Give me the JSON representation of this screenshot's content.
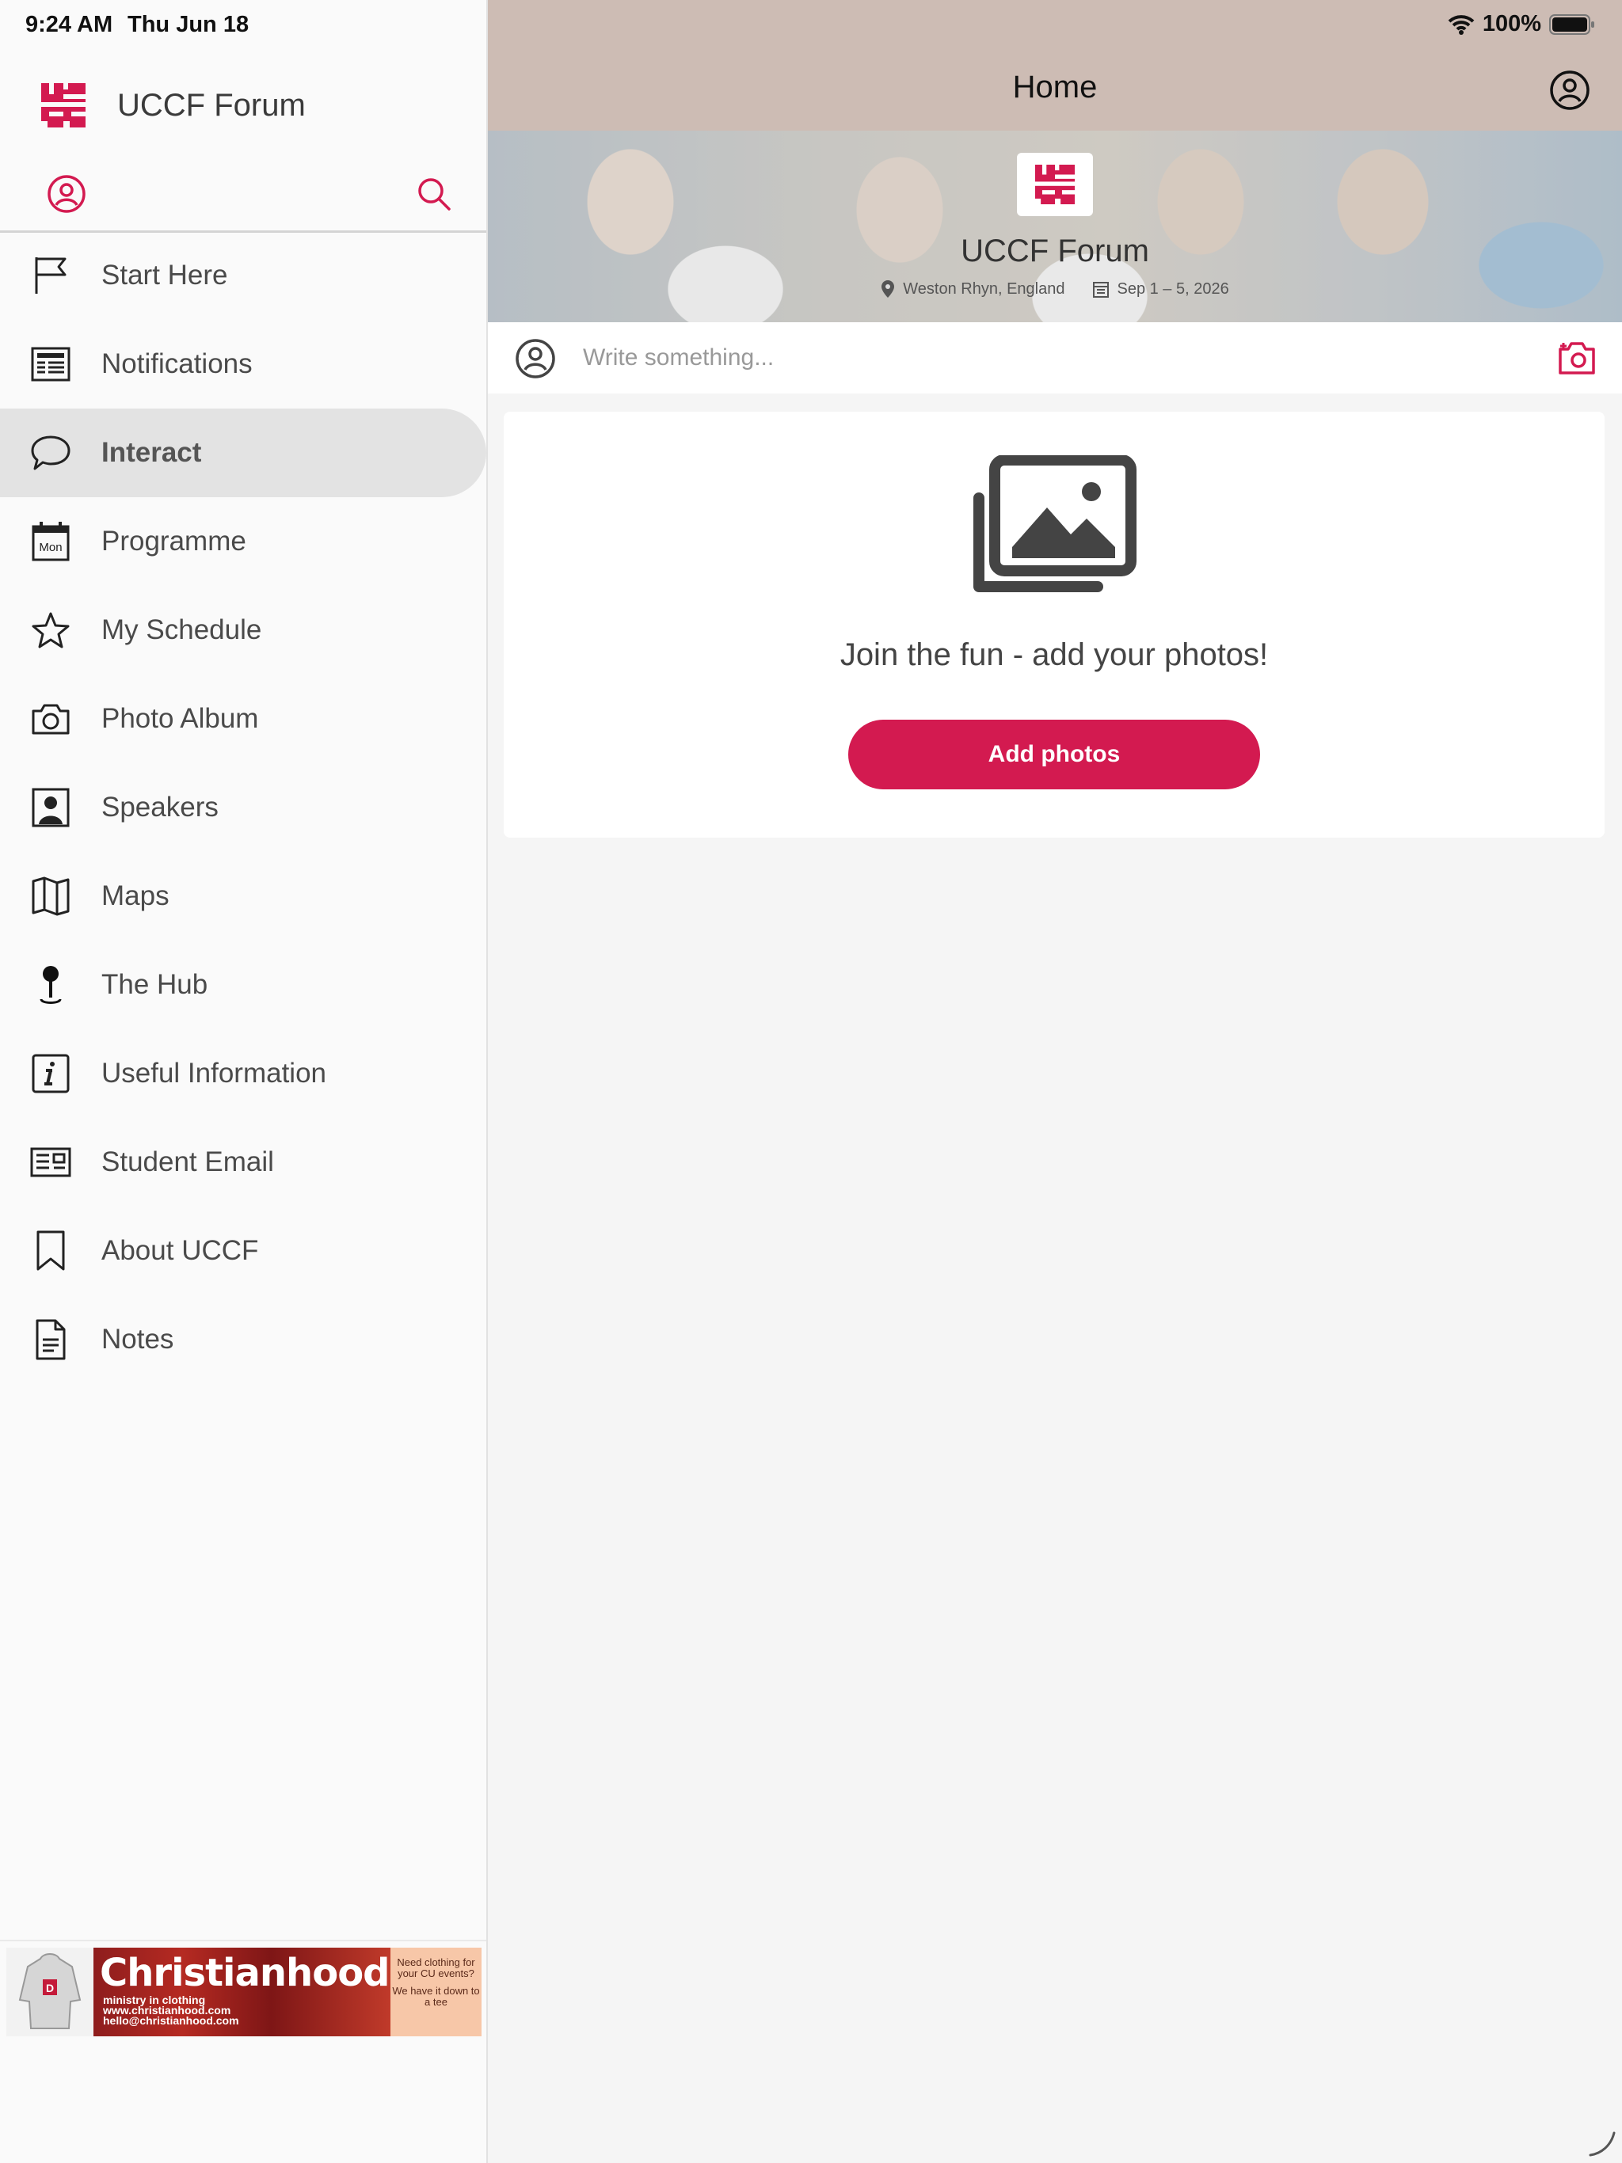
{
  "status_bar": {
    "time": "9:24 AM",
    "date": "Thu Jun 18",
    "battery": "100%"
  },
  "sidebar": {
    "title": "UCCF Forum",
    "items": [
      {
        "label": "Start Here",
        "icon": "flag-icon"
      },
      {
        "label": "Notifications",
        "icon": "newspaper-icon"
      },
      {
        "label": "Interact",
        "icon": "chat-bubble-icon",
        "active": true
      },
      {
        "label": "Programme",
        "icon": "calendar-icon",
        "icon_text": "Mon"
      },
      {
        "label": "My Schedule",
        "icon": "star-icon"
      },
      {
        "label": "Photo Album",
        "icon": "camera-icon"
      },
      {
        "label": "Speakers",
        "icon": "person-card-icon"
      },
      {
        "label": "Maps",
        "icon": "map-icon"
      },
      {
        "label": "The Hub",
        "icon": "map-pin-icon"
      },
      {
        "label": "Useful Information",
        "icon": "info-icon"
      },
      {
        "label": "Student Email",
        "icon": "mail-card-icon"
      },
      {
        "label": "About UCCF",
        "icon": "bookmark-icon"
      },
      {
        "label": "Notes",
        "icon": "document-icon"
      }
    ],
    "ad": {
      "brand": "Christianhood",
      "tagline": "ministry in clothing",
      "web": "www.christianhood.com",
      "email": "hello@christianhood.com",
      "side_text_1": "Need clothing for your CU events?",
      "side_text_2": "We have it down to a tee"
    }
  },
  "main": {
    "title": "Home",
    "hero": {
      "title": "UCCF Forum",
      "location": "Weston Rhyn, England",
      "dates": "Sep 1 – 5, 2026"
    },
    "composer": {
      "placeholder": "Write something..."
    },
    "photos": {
      "message": "Join the fun - add your photos!",
      "button": "Add photos"
    }
  },
  "colors": {
    "accent": "#d31a50",
    "topbar": "#cdbcb4",
    "active_item": "#e3e3e3",
    "icon_dark": "#4a4a4a"
  }
}
